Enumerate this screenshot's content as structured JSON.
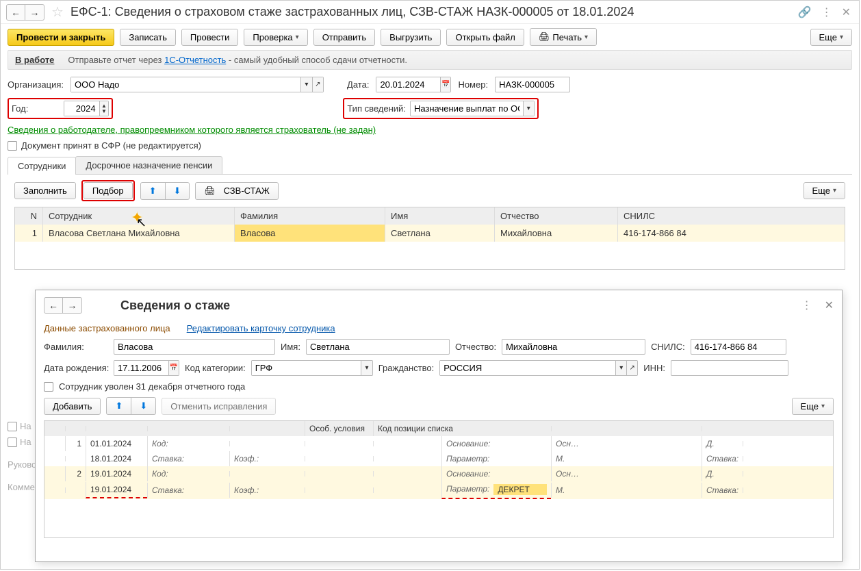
{
  "header": {
    "title": "ЕФС-1: Сведения о страховом стаже застрахованных лиц, СЗВ-СТАЖ НАЗК-000005 от 18.01.2024"
  },
  "toolbar": {
    "post_close": "Провести и закрыть",
    "save": "Записать",
    "post": "Провести",
    "check": "Проверка",
    "send": "Отправить",
    "export": "Выгрузить",
    "open_file": "Открыть файл",
    "print": "Печать",
    "more": "Еще"
  },
  "status": {
    "label": "В работе",
    "text_prefix": "Отправьте отчет через ",
    "link": "1С-Отчетность",
    "text_suffix": " - самый удобный способ сдачи отчетности."
  },
  "form": {
    "org_label": "Организация:",
    "org_value": "ООО Надо",
    "date_label": "Дата:",
    "date_value": "20.01.2024",
    "num_label": "Номер:",
    "num_value": "НАЗК-000005",
    "year_label": "Год:",
    "year_value": "2024",
    "type_label": "Тип сведений:",
    "type_value": "Назначение выплат по ОС",
    "employer_link": "Сведения о работодателе, правопреемником которого является страхователь (не задан)",
    "accepted_label": "Документ принят в СФР (не редактируется)"
  },
  "tabs": {
    "tab1": "Сотрудники",
    "tab2": "Досрочное назначение пенсии"
  },
  "table_toolbar": {
    "fill": "Заполнить",
    "pick": "Подбор",
    "szv": "СЗВ-СТАЖ",
    "more": "Еще"
  },
  "table_headers": {
    "n": "N",
    "emp": "Сотрудник",
    "fam": "Фамилия",
    "name": "Имя",
    "patr": "Отчество",
    "snils": "СНИЛС"
  },
  "table_rows": [
    {
      "n": "1",
      "emp": "Власова Светлана Михайловна",
      "fam": "Власова",
      "name": "Светлана",
      "patr": "Михайловна",
      "snils": "416-174-866 84"
    }
  ],
  "cut_fields": {
    "na1": "На",
    "na2": "На",
    "ruk": "Руково",
    "kom": "Комме"
  },
  "modal": {
    "title": "Сведения о стаже",
    "section_label": "Данные застрахованного лица",
    "edit_link": "Редактировать карточку сотрудника",
    "fam_label": "Фамилия:",
    "fam_value": "Власова",
    "name_label": "Имя:",
    "name_value": "Светлана",
    "patr_label": "Отчество:",
    "patr_value": "Михайловна",
    "snils_label": "СНИЛС:",
    "snils_value": "416-174-866 84",
    "dob_label": "Дата рождения:",
    "dob_value": "17.11.2006",
    "cat_label": "Код категории:",
    "cat_value": "ГРФ",
    "cit_label": "Гражданство:",
    "cit_value": "РОССИЯ",
    "inn_label": "ИНН:",
    "inn_value": "",
    "fired_label": "Сотрудник уволен 31 декабря отчетного года",
    "add": "Добавить",
    "undo": "Отменить исправления",
    "more": "Еще",
    "col_osob": "Особ. условия",
    "col_pos": "Код позиции списка",
    "periods": [
      {
        "n": "1",
        "d1": "01.01.2024",
        "d2": "18.01.2024",
        "kod": "Код:",
        "stavka": "Ставка:",
        "koef": "Коэф.:",
        "osn": "Основание:",
        "param": "Параметр:",
        "osn2": "Осн…",
        "m": "М.",
        "d": "Д.",
        "stav2": "Ставка:",
        "param_val": ""
      },
      {
        "n": "2",
        "d1": "19.01.2024",
        "d2": "19.01.2024",
        "kod": "Код:",
        "stavka": "Ставка:",
        "koef": "Коэф.:",
        "osn": "Основание:",
        "param": "Параметр:",
        "osn2": "Осн…",
        "m": "М.",
        "d": "Д.",
        "stav2": "Ставка:",
        "param_val": "ДЕКРЕТ"
      }
    ]
  }
}
